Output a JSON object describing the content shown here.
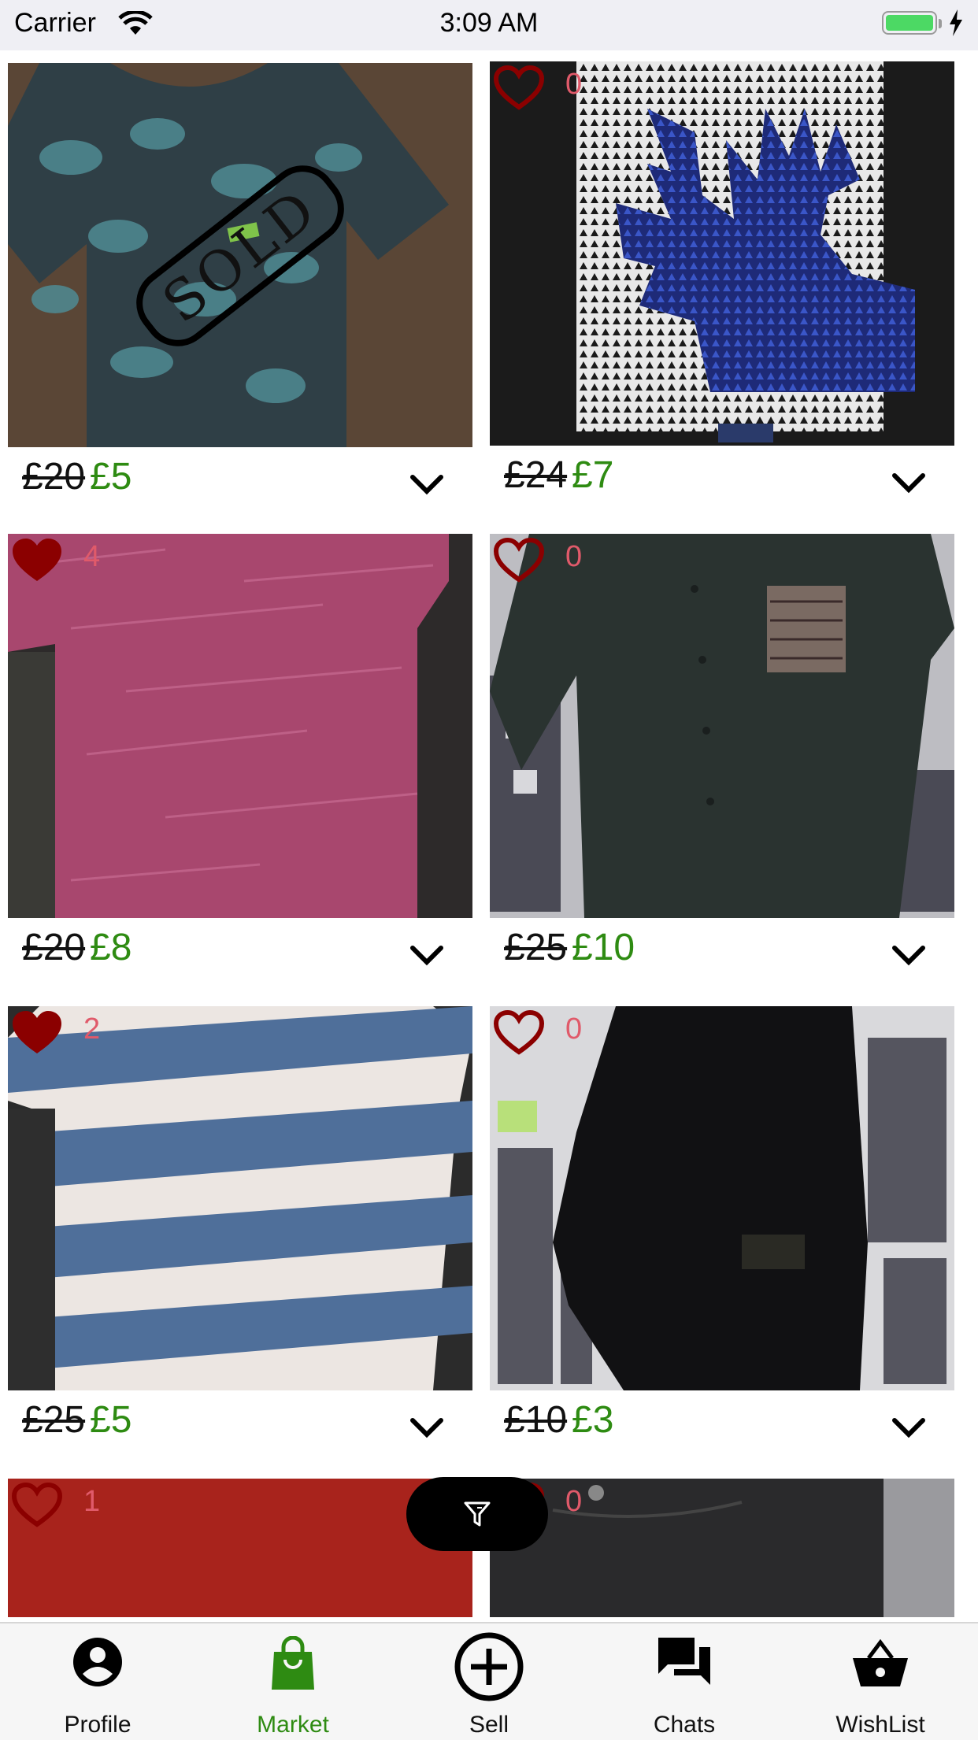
{
  "status_bar": {
    "carrier": "Carrier",
    "time": "3:09 AM"
  },
  "colors": {
    "accent": "#2e8b12",
    "heart": "#8b0000",
    "like_count": "#e05a6a",
    "tab_active": "#2e8b12"
  },
  "listings": [
    {
      "old_price": "£20",
      "new_price": "£5",
      "sold_label": "SOLD",
      "image": "dark floral t-shirt"
    },
    {
      "likes": "0",
      "liked": false,
      "old_price": "£24",
      "new_price": "£7",
      "image": "black t-shirt with blue stag print"
    },
    {
      "likes": "4",
      "liked": true,
      "old_price": "£20",
      "new_price": "£8",
      "image": "pink marl t-shirt"
    },
    {
      "likes": "0",
      "liked": false,
      "old_price": "£25",
      "new_price": "£10",
      "image": "dark green shirt with patterned pocket"
    },
    {
      "likes": "2",
      "liked": true,
      "old_price": "£25",
      "new_price": "£5",
      "image": "blue and white striped t-shirt"
    },
    {
      "likes": "0",
      "liked": false,
      "old_price": "£10",
      "new_price": "£3",
      "image": "black joggers"
    },
    {
      "likes": "1",
      "liked": false,
      "image": "red garment"
    },
    {
      "likes": "0",
      "liked": false,
      "image": "dark jeans"
    }
  ],
  "tabs": [
    {
      "label": "Profile",
      "icon": "profile-icon",
      "active": false
    },
    {
      "label": "Market",
      "icon": "shopping-bag-icon",
      "active": true
    },
    {
      "label": "Sell",
      "icon": "plus-circle-icon",
      "active": false
    },
    {
      "label": "Chats",
      "icon": "chat-icon",
      "active": false
    },
    {
      "label": "WishList",
      "icon": "basket-icon",
      "active": false
    }
  ]
}
